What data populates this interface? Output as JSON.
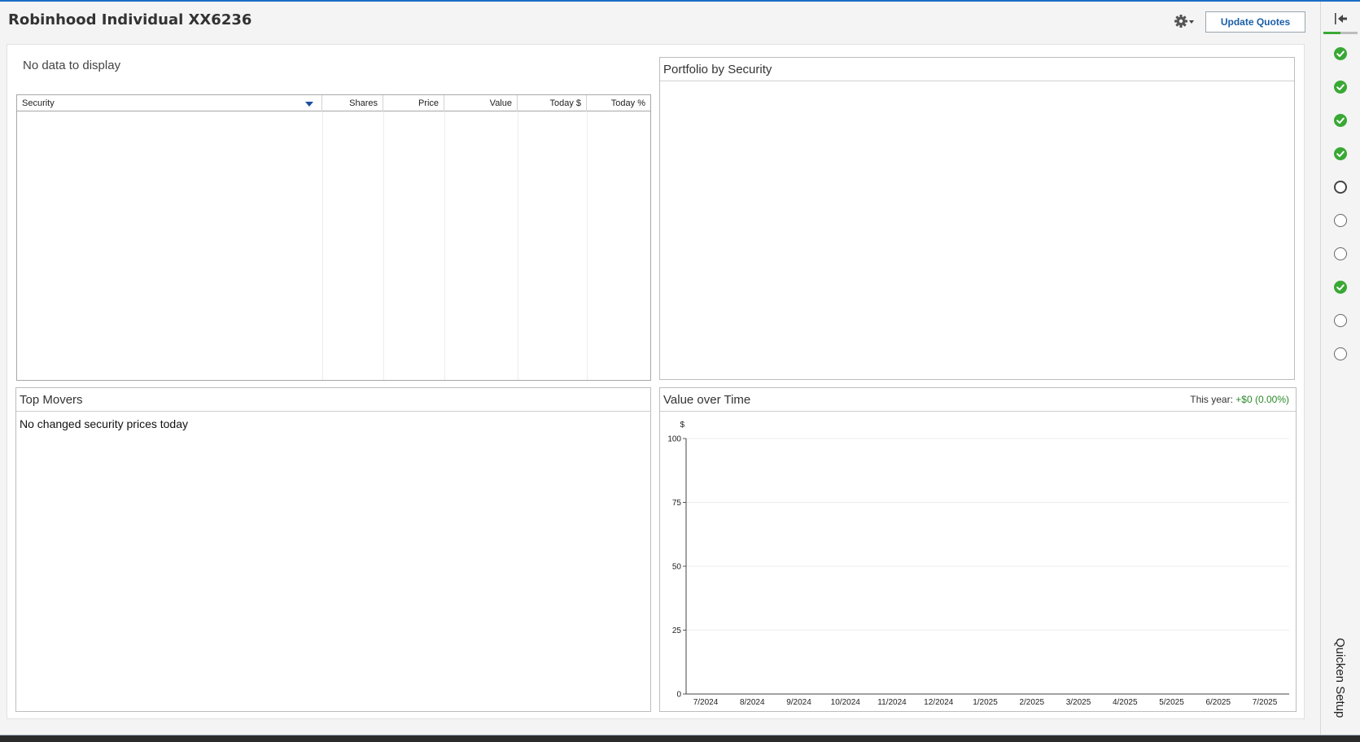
{
  "header": {
    "account_title": "Robinhood Individual XX6236",
    "update_quotes_label": "Update Quotes"
  },
  "holdings": {
    "empty_message": "No data to display",
    "columns": [
      "Security",
      "Shares",
      "Price",
      "Value",
      "Today $",
      "Today %"
    ]
  },
  "portfolio_panel": {
    "title": "Portfolio by Security"
  },
  "top_movers": {
    "title": "Top Movers",
    "empty_message": "No changed security prices today"
  },
  "value_over_time": {
    "title": "Value over Time",
    "this_year_label": "This year:",
    "this_year_value": "+$0 (0.00%)"
  },
  "chart_data": {
    "type": "line",
    "title": "Value over Time",
    "xlabel": "",
    "ylabel": "$",
    "categories": [
      "7/2024",
      "8/2024",
      "9/2024",
      "10/2024",
      "11/2024",
      "12/2024",
      "1/2025",
      "2/2025",
      "3/2025",
      "4/2025",
      "5/2025",
      "6/2025",
      "7/2025"
    ],
    "yticks": [
      "0",
      "25",
      "50",
      "75",
      "100"
    ],
    "ylim": [
      0,
      100
    ],
    "series": [],
    "grid": true
  },
  "setup_rail": {
    "label": "Quicken Setup",
    "progress": 0.5,
    "steps": [
      {
        "status": "done"
      },
      {
        "status": "done"
      },
      {
        "status": "done"
      },
      {
        "status": "done"
      },
      {
        "status": "current"
      },
      {
        "status": "open"
      },
      {
        "status": "open"
      },
      {
        "status": "done"
      },
      {
        "status": "open"
      },
      {
        "status": "open"
      }
    ]
  },
  "colors": {
    "accent": "#1a6ec4",
    "positive": "#2a8a2a",
    "step_done": "#39a834",
    "link_blue": "#1a5fa8"
  }
}
